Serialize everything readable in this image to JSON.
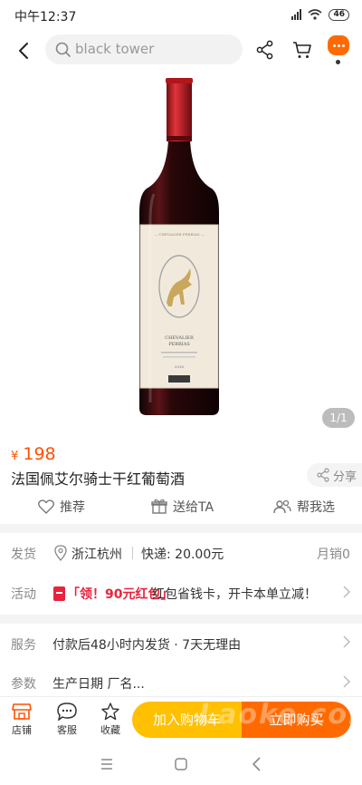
{
  "status_bar": {
    "time": "中午12:37",
    "battery": "46"
  },
  "search": {
    "placeholder": "black tower"
  },
  "gallery": {
    "pager": "1/1"
  },
  "product": {
    "price_symbol": "¥",
    "price": "198",
    "title": "法国佩艾尔骑士干红葡萄酒",
    "share_label": "分享"
  },
  "actions": [
    {
      "label": "推荐",
      "icon": "heart-icon"
    },
    {
      "label": "送给TA",
      "icon": "gift-icon"
    },
    {
      "label": "帮我选",
      "icon": "people-icon"
    }
  ],
  "shipping": {
    "label": "发货",
    "location": "浙江杭州",
    "fee": "快递: 20.00元",
    "monthly_sales": "月销0"
  },
  "promo": {
    "label": "活动",
    "red_text": "「领！90元红包」",
    "text": "红包省钱卡，开卡本单立减！"
  },
  "service": {
    "label": "服务",
    "text": "付款后48小时内发货 · 7天无理由"
  },
  "params": {
    "label": "参数",
    "text": "生产日期 厂名..."
  },
  "bottom_bar": {
    "store": "店铺",
    "service": "客服",
    "favorite": "收藏",
    "add_to_cart": "加入购物车",
    "buy_now": "立即购买",
    "watermark": "Laoke.com"
  },
  "colors": {
    "accent": "#ff5000",
    "orange": "#ff6a00",
    "yellow": "#ffc000",
    "promo_red": "#e8233d"
  }
}
